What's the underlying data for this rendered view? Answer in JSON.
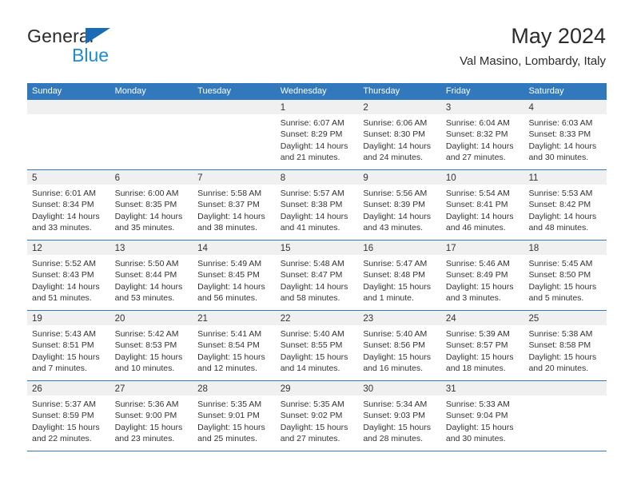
{
  "brand": {
    "name_top": "General",
    "name_bottom": "Blue",
    "triangle_icon": "triangle-logo-icon",
    "accent_color": "#1e8bd4",
    "dark_color": "#2b2b2b"
  },
  "header": {
    "title": "May 2024",
    "subtitle": "Val Masino, Lombardy, Italy"
  },
  "calendar": {
    "header_color": "#3179bc",
    "weekdays": [
      "Sunday",
      "Monday",
      "Tuesday",
      "Wednesday",
      "Thursday",
      "Friday",
      "Saturday"
    ],
    "weeks": [
      [
        {
          "day": "",
          "sunrise": "",
          "sunset": "",
          "daylight1": "",
          "daylight2": ""
        },
        {
          "day": "",
          "sunrise": "",
          "sunset": "",
          "daylight1": "",
          "daylight2": ""
        },
        {
          "day": "",
          "sunrise": "",
          "sunset": "",
          "daylight1": "",
          "daylight2": ""
        },
        {
          "day": "1",
          "sunrise": "Sunrise: 6:07 AM",
          "sunset": "Sunset: 8:29 PM",
          "daylight1": "Daylight: 14 hours",
          "daylight2": "and 21 minutes."
        },
        {
          "day": "2",
          "sunrise": "Sunrise: 6:06 AM",
          "sunset": "Sunset: 8:30 PM",
          "daylight1": "Daylight: 14 hours",
          "daylight2": "and 24 minutes."
        },
        {
          "day": "3",
          "sunrise": "Sunrise: 6:04 AM",
          "sunset": "Sunset: 8:32 PM",
          "daylight1": "Daylight: 14 hours",
          "daylight2": "and 27 minutes."
        },
        {
          "day": "4",
          "sunrise": "Sunrise: 6:03 AM",
          "sunset": "Sunset: 8:33 PM",
          "daylight1": "Daylight: 14 hours",
          "daylight2": "and 30 minutes."
        }
      ],
      [
        {
          "day": "5",
          "sunrise": "Sunrise: 6:01 AM",
          "sunset": "Sunset: 8:34 PM",
          "daylight1": "Daylight: 14 hours",
          "daylight2": "and 33 minutes."
        },
        {
          "day": "6",
          "sunrise": "Sunrise: 6:00 AM",
          "sunset": "Sunset: 8:35 PM",
          "daylight1": "Daylight: 14 hours",
          "daylight2": "and 35 minutes."
        },
        {
          "day": "7",
          "sunrise": "Sunrise: 5:58 AM",
          "sunset": "Sunset: 8:37 PM",
          "daylight1": "Daylight: 14 hours",
          "daylight2": "and 38 minutes."
        },
        {
          "day": "8",
          "sunrise": "Sunrise: 5:57 AM",
          "sunset": "Sunset: 8:38 PM",
          "daylight1": "Daylight: 14 hours",
          "daylight2": "and 41 minutes."
        },
        {
          "day": "9",
          "sunrise": "Sunrise: 5:56 AM",
          "sunset": "Sunset: 8:39 PM",
          "daylight1": "Daylight: 14 hours",
          "daylight2": "and 43 minutes."
        },
        {
          "day": "10",
          "sunrise": "Sunrise: 5:54 AM",
          "sunset": "Sunset: 8:41 PM",
          "daylight1": "Daylight: 14 hours",
          "daylight2": "and 46 minutes."
        },
        {
          "day": "11",
          "sunrise": "Sunrise: 5:53 AM",
          "sunset": "Sunset: 8:42 PM",
          "daylight1": "Daylight: 14 hours",
          "daylight2": "and 48 minutes."
        }
      ],
      [
        {
          "day": "12",
          "sunrise": "Sunrise: 5:52 AM",
          "sunset": "Sunset: 8:43 PM",
          "daylight1": "Daylight: 14 hours",
          "daylight2": "and 51 minutes."
        },
        {
          "day": "13",
          "sunrise": "Sunrise: 5:50 AM",
          "sunset": "Sunset: 8:44 PM",
          "daylight1": "Daylight: 14 hours",
          "daylight2": "and 53 minutes."
        },
        {
          "day": "14",
          "sunrise": "Sunrise: 5:49 AM",
          "sunset": "Sunset: 8:45 PM",
          "daylight1": "Daylight: 14 hours",
          "daylight2": "and 56 minutes."
        },
        {
          "day": "15",
          "sunrise": "Sunrise: 5:48 AM",
          "sunset": "Sunset: 8:47 PM",
          "daylight1": "Daylight: 14 hours",
          "daylight2": "and 58 minutes."
        },
        {
          "day": "16",
          "sunrise": "Sunrise: 5:47 AM",
          "sunset": "Sunset: 8:48 PM",
          "daylight1": "Daylight: 15 hours",
          "daylight2": "and 1 minute."
        },
        {
          "day": "17",
          "sunrise": "Sunrise: 5:46 AM",
          "sunset": "Sunset: 8:49 PM",
          "daylight1": "Daylight: 15 hours",
          "daylight2": "and 3 minutes."
        },
        {
          "day": "18",
          "sunrise": "Sunrise: 5:45 AM",
          "sunset": "Sunset: 8:50 PM",
          "daylight1": "Daylight: 15 hours",
          "daylight2": "and 5 minutes."
        }
      ],
      [
        {
          "day": "19",
          "sunrise": "Sunrise: 5:43 AM",
          "sunset": "Sunset: 8:51 PM",
          "daylight1": "Daylight: 15 hours",
          "daylight2": "and 7 minutes."
        },
        {
          "day": "20",
          "sunrise": "Sunrise: 5:42 AM",
          "sunset": "Sunset: 8:53 PM",
          "daylight1": "Daylight: 15 hours",
          "daylight2": "and 10 minutes."
        },
        {
          "day": "21",
          "sunrise": "Sunrise: 5:41 AM",
          "sunset": "Sunset: 8:54 PM",
          "daylight1": "Daylight: 15 hours",
          "daylight2": "and 12 minutes."
        },
        {
          "day": "22",
          "sunrise": "Sunrise: 5:40 AM",
          "sunset": "Sunset: 8:55 PM",
          "daylight1": "Daylight: 15 hours",
          "daylight2": "and 14 minutes."
        },
        {
          "day": "23",
          "sunrise": "Sunrise: 5:40 AM",
          "sunset": "Sunset: 8:56 PM",
          "daylight1": "Daylight: 15 hours",
          "daylight2": "and 16 minutes."
        },
        {
          "day": "24",
          "sunrise": "Sunrise: 5:39 AM",
          "sunset": "Sunset: 8:57 PM",
          "daylight1": "Daylight: 15 hours",
          "daylight2": "and 18 minutes."
        },
        {
          "day": "25",
          "sunrise": "Sunrise: 5:38 AM",
          "sunset": "Sunset: 8:58 PM",
          "daylight1": "Daylight: 15 hours",
          "daylight2": "and 20 minutes."
        }
      ],
      [
        {
          "day": "26",
          "sunrise": "Sunrise: 5:37 AM",
          "sunset": "Sunset: 8:59 PM",
          "daylight1": "Daylight: 15 hours",
          "daylight2": "and 22 minutes."
        },
        {
          "day": "27",
          "sunrise": "Sunrise: 5:36 AM",
          "sunset": "Sunset: 9:00 PM",
          "daylight1": "Daylight: 15 hours",
          "daylight2": "and 23 minutes."
        },
        {
          "day": "28",
          "sunrise": "Sunrise: 5:35 AM",
          "sunset": "Sunset: 9:01 PM",
          "daylight1": "Daylight: 15 hours",
          "daylight2": "and 25 minutes."
        },
        {
          "day": "29",
          "sunrise": "Sunrise: 5:35 AM",
          "sunset": "Sunset: 9:02 PM",
          "daylight1": "Daylight: 15 hours",
          "daylight2": "and 27 minutes."
        },
        {
          "day": "30",
          "sunrise": "Sunrise: 5:34 AM",
          "sunset": "Sunset: 9:03 PM",
          "daylight1": "Daylight: 15 hours",
          "daylight2": "and 28 minutes."
        },
        {
          "day": "31",
          "sunrise": "Sunrise: 5:33 AM",
          "sunset": "Sunset: 9:04 PM",
          "daylight1": "Daylight: 15 hours",
          "daylight2": "and 30 minutes."
        },
        {
          "day": "",
          "sunrise": "",
          "sunset": "",
          "daylight1": "",
          "daylight2": ""
        }
      ]
    ]
  }
}
